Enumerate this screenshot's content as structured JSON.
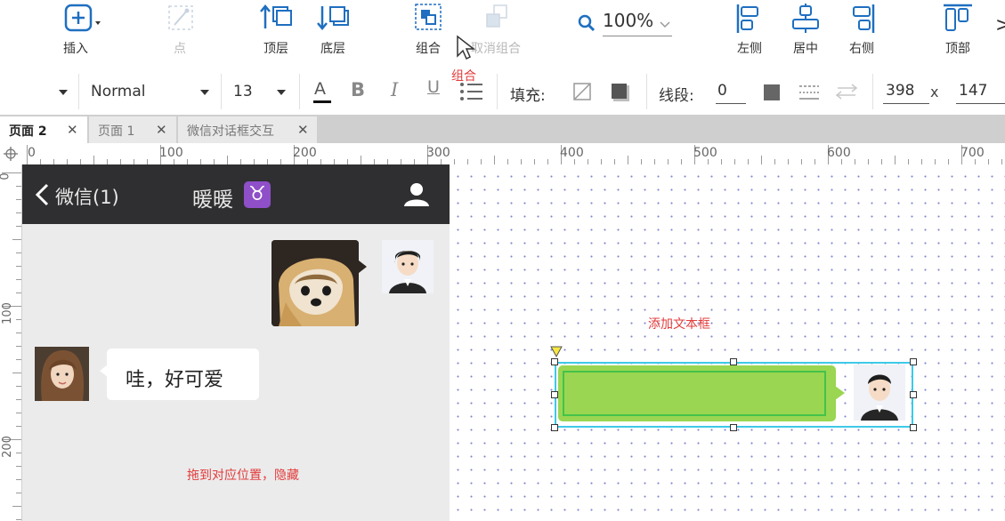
{
  "toolbar": {
    "insert_label": "插入",
    "point_label": "点",
    "top_layer_label": "顶层",
    "bottom_layer_label": "底层",
    "group_label": "组合",
    "ungroup_label": "取消组合",
    "zoom_value": "100%",
    "align_left_label": "左侧",
    "align_center_label": "居中",
    "align_right_label": "右侧",
    "align_top_label": "顶部",
    "more_glyph": ">"
  },
  "format_bar": {
    "style_value": "Normal",
    "font_size": "13",
    "bold_glyph": "B",
    "italic_glyph": "I",
    "underline_glyph": "U",
    "font_color_glyph": "A",
    "fill_label": "填充:",
    "stroke_label": "线段:",
    "stroke_value": "0",
    "x_value": "398",
    "x_separator": "x",
    "y_value": "147"
  },
  "tabs": [
    {
      "label": "页面 2",
      "active": true
    },
    {
      "label": "页面 1",
      "active": false
    },
    {
      "label": "微信对话框交互",
      "active": false
    }
  ],
  "ruler": {
    "top_labels": [
      "0",
      "100",
      "200",
      "300",
      "400",
      "500",
      "600",
      "700"
    ],
    "left_labels": [
      "0",
      "100",
      "200"
    ]
  },
  "phone": {
    "back_label": "微信(1)",
    "chat_title": "暖暖",
    "zodiac_glyph": "♉",
    "received_message": "哇，好可爱"
  },
  "annotations": {
    "group_hint": "组合",
    "add_textbox": "添加文本框",
    "drag_hide": "拖到对应位置，隐藏"
  },
  "colors": {
    "accent_blue": "#1f6fc0",
    "bubble_green": "#9ad651",
    "selection_cyan": "#3ec9e8",
    "annotation_red": "#e23b3b",
    "phone_header": "#2f2f31"
  }
}
